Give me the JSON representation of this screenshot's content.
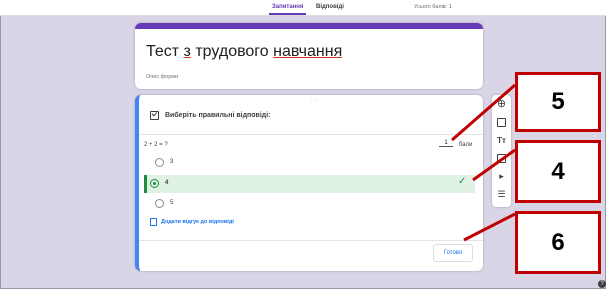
{
  "header": {
    "tab_questions": "Запитання",
    "tab_answers": "Відповіді",
    "total_score": "Усього балів: 1"
  },
  "form": {
    "title_part1": "Тест ",
    "title_part2": "з",
    "title_part3": " трудового ",
    "title_part4": "навчання",
    "description_placeholder": "Опис форми"
  },
  "question_card": {
    "drag_handle": ":::",
    "header_text": "Виберіть правильні відповіді:",
    "question_text": "2 + 2 = ?",
    "points_value": "1",
    "points_unit": "бали",
    "options": [
      "3",
      "4",
      "5"
    ],
    "correct_option_index": 1,
    "feedback_link": "Додати відгук до відповіді",
    "done_button": "Готово"
  },
  "toolbar": {
    "icons": [
      "add-question-icon",
      "import-questions-icon",
      "add-title-icon",
      "add-image-icon",
      "add-video-icon",
      "add-section-icon"
    ]
  },
  "callouts": [
    "5",
    "4",
    "6"
  ],
  "colors": {
    "accent": "#673ab7",
    "correct": "#1e8e3e",
    "callout_border": "#c00000",
    "link": "#1a73e8"
  }
}
